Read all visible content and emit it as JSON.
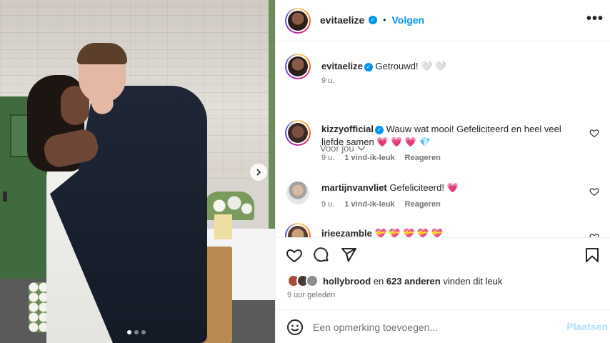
{
  "post": {
    "username": "evitaelize",
    "follow_label": "Volgen",
    "separator": "•",
    "more_label": "•••",
    "carousel_pages": 3,
    "carousel_active": 1
  },
  "caption": {
    "username": "evitaelize",
    "text": "Getrouwd! 🤍 🤍",
    "time": "9 u."
  },
  "sort_label": "Voor jou",
  "comments": [
    {
      "username": "kizzyofficial",
      "text": "Wauw wat mooi! Gefeliciteerd en heel veel liefde samen 💗 💗 💗 💎",
      "time": "9 u.",
      "likes": "1 vind-ik-leuk",
      "reply": "Reageren"
    },
    {
      "username": "martijnvanvliet",
      "text": "Gefeliciteerd! 💗",
      "time": "9 u.",
      "likes": "1 vind-ik-leuk",
      "reply": "Reageren"
    },
    {
      "username": "irieezamble",
      "text": "💝 💝 💝 💝 💝"
    }
  ],
  "likes": {
    "user": "hollybrood",
    "text_mid": " en ",
    "count": "623 anderen",
    "text_end": " vinden dit leuk"
  },
  "time_ago": "9 uur geleden",
  "comment_box": {
    "placeholder": "Een opmerking toevoegen...",
    "post_label": "Plaatsen"
  },
  "colors": {
    "accent": "#0095f6",
    "muted": "#737373",
    "heart": "#ed4956"
  }
}
